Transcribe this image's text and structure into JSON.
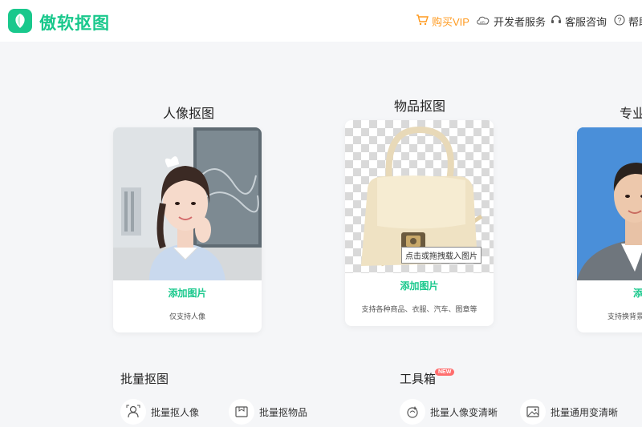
{
  "header": {
    "brand": "傲软抠图",
    "nav": [
      {
        "label": "购买VIP",
        "icon": "cart-icon"
      },
      {
        "label": "开发者服务",
        "icon": "api-icon"
      },
      {
        "label": "客服咨询",
        "icon": "headset-icon"
      },
      {
        "label": "帮助",
        "icon": "help-icon"
      }
    ],
    "api_badge": "API"
  },
  "cards": [
    {
      "title": "人像抠图",
      "add": "添加图片",
      "desc": "仅支持人像"
    },
    {
      "title": "物品抠图",
      "add": "添加图片",
      "desc": "支持各种商品、衣服、汽车、图章等",
      "tooltip": "点击或拖拽载入图片"
    },
    {
      "title": "专业",
      "add": "添",
      "desc": "支持换背景、"
    }
  ],
  "batch": {
    "title": "批量抠图",
    "items": [
      {
        "label": "批量抠人像",
        "icon": "person-outline-icon"
      },
      {
        "label": "批量抠物品",
        "icon": "box-outline-icon"
      }
    ]
  },
  "toolbox": {
    "title": "工具箱",
    "badge": "NEW",
    "items": [
      {
        "label": "批量人像变清晰",
        "icon": "face-enhance-icon"
      },
      {
        "label": "批量通用变清晰",
        "icon": "image-enhance-icon"
      }
    ]
  },
  "colors": {
    "brand": "#19c88c",
    "vip": "#ff9a1f",
    "new_badge": "#ff6d6d",
    "id_photo_bg": "#4a8fd9"
  }
}
